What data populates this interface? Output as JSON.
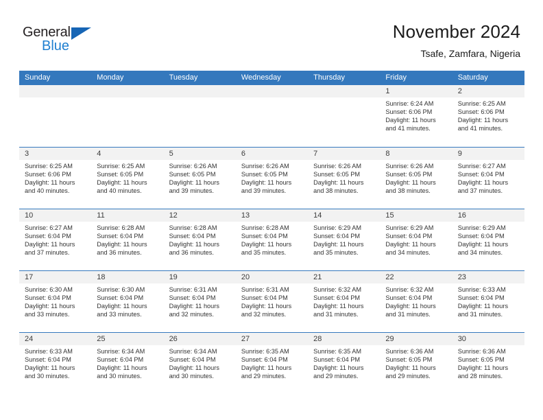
{
  "brand": {
    "name_part1": "General",
    "name_part2": "Blue",
    "triangle_color": "#1665b5",
    "blue_color": "#1f7fd0"
  },
  "header": {
    "title": "November 2024",
    "subtitle": "Tsafe, Zamfara, Nigeria"
  },
  "theme": {
    "header_bg": "#3478bd",
    "date_band_bg": "#f2f2f2",
    "row_border": "#3478bd",
    "text": "#333333"
  },
  "weekdays": [
    "Sunday",
    "Monday",
    "Tuesday",
    "Wednesday",
    "Thursday",
    "Friday",
    "Saturday"
  ],
  "weeks": [
    [
      {
        "date": "",
        "empty": true,
        "sunrise": "",
        "sunset": "",
        "daylight_line1": "",
        "daylight_line2": ""
      },
      {
        "date": "",
        "empty": true,
        "sunrise": "",
        "sunset": "",
        "daylight_line1": "",
        "daylight_line2": ""
      },
      {
        "date": "",
        "empty": true,
        "sunrise": "",
        "sunset": "",
        "daylight_line1": "",
        "daylight_line2": ""
      },
      {
        "date": "",
        "empty": true,
        "sunrise": "",
        "sunset": "",
        "daylight_line1": "",
        "daylight_line2": ""
      },
      {
        "date": "",
        "empty": true,
        "sunrise": "",
        "sunset": "",
        "daylight_line1": "",
        "daylight_line2": ""
      },
      {
        "date": "1",
        "empty": false,
        "sunrise": "Sunrise: 6:24 AM",
        "sunset": "Sunset: 6:06 PM",
        "daylight_line1": "Daylight: 11 hours",
        "daylight_line2": "and 41 minutes."
      },
      {
        "date": "2",
        "empty": false,
        "sunrise": "Sunrise: 6:25 AM",
        "sunset": "Sunset: 6:06 PM",
        "daylight_line1": "Daylight: 11 hours",
        "daylight_line2": "and 41 minutes."
      }
    ],
    [
      {
        "date": "3",
        "empty": false,
        "sunrise": "Sunrise: 6:25 AM",
        "sunset": "Sunset: 6:06 PM",
        "daylight_line1": "Daylight: 11 hours",
        "daylight_line2": "and 40 minutes."
      },
      {
        "date": "4",
        "empty": false,
        "sunrise": "Sunrise: 6:25 AM",
        "sunset": "Sunset: 6:05 PM",
        "daylight_line1": "Daylight: 11 hours",
        "daylight_line2": "and 40 minutes."
      },
      {
        "date": "5",
        "empty": false,
        "sunrise": "Sunrise: 6:26 AM",
        "sunset": "Sunset: 6:05 PM",
        "daylight_line1": "Daylight: 11 hours",
        "daylight_line2": "and 39 minutes."
      },
      {
        "date": "6",
        "empty": false,
        "sunrise": "Sunrise: 6:26 AM",
        "sunset": "Sunset: 6:05 PM",
        "daylight_line1": "Daylight: 11 hours",
        "daylight_line2": "and 39 minutes."
      },
      {
        "date": "7",
        "empty": false,
        "sunrise": "Sunrise: 6:26 AM",
        "sunset": "Sunset: 6:05 PM",
        "daylight_line1": "Daylight: 11 hours",
        "daylight_line2": "and 38 minutes."
      },
      {
        "date": "8",
        "empty": false,
        "sunrise": "Sunrise: 6:26 AM",
        "sunset": "Sunset: 6:05 PM",
        "daylight_line1": "Daylight: 11 hours",
        "daylight_line2": "and 38 minutes."
      },
      {
        "date": "9",
        "empty": false,
        "sunrise": "Sunrise: 6:27 AM",
        "sunset": "Sunset: 6:04 PM",
        "daylight_line1": "Daylight: 11 hours",
        "daylight_line2": "and 37 minutes."
      }
    ],
    [
      {
        "date": "10",
        "empty": false,
        "sunrise": "Sunrise: 6:27 AM",
        "sunset": "Sunset: 6:04 PM",
        "daylight_line1": "Daylight: 11 hours",
        "daylight_line2": "and 37 minutes."
      },
      {
        "date": "11",
        "empty": false,
        "sunrise": "Sunrise: 6:28 AM",
        "sunset": "Sunset: 6:04 PM",
        "daylight_line1": "Daylight: 11 hours",
        "daylight_line2": "and 36 minutes."
      },
      {
        "date": "12",
        "empty": false,
        "sunrise": "Sunrise: 6:28 AM",
        "sunset": "Sunset: 6:04 PM",
        "daylight_line1": "Daylight: 11 hours",
        "daylight_line2": "and 36 minutes."
      },
      {
        "date": "13",
        "empty": false,
        "sunrise": "Sunrise: 6:28 AM",
        "sunset": "Sunset: 6:04 PM",
        "daylight_line1": "Daylight: 11 hours",
        "daylight_line2": "and 35 minutes."
      },
      {
        "date": "14",
        "empty": false,
        "sunrise": "Sunrise: 6:29 AM",
        "sunset": "Sunset: 6:04 PM",
        "daylight_line1": "Daylight: 11 hours",
        "daylight_line2": "and 35 minutes."
      },
      {
        "date": "15",
        "empty": false,
        "sunrise": "Sunrise: 6:29 AM",
        "sunset": "Sunset: 6:04 PM",
        "daylight_line1": "Daylight: 11 hours",
        "daylight_line2": "and 34 minutes."
      },
      {
        "date": "16",
        "empty": false,
        "sunrise": "Sunrise: 6:29 AM",
        "sunset": "Sunset: 6:04 PM",
        "daylight_line1": "Daylight: 11 hours",
        "daylight_line2": "and 34 minutes."
      }
    ],
    [
      {
        "date": "17",
        "empty": false,
        "sunrise": "Sunrise: 6:30 AM",
        "sunset": "Sunset: 6:04 PM",
        "daylight_line1": "Daylight: 11 hours",
        "daylight_line2": "and 33 minutes."
      },
      {
        "date": "18",
        "empty": false,
        "sunrise": "Sunrise: 6:30 AM",
        "sunset": "Sunset: 6:04 PM",
        "daylight_line1": "Daylight: 11 hours",
        "daylight_line2": "and 33 minutes."
      },
      {
        "date": "19",
        "empty": false,
        "sunrise": "Sunrise: 6:31 AM",
        "sunset": "Sunset: 6:04 PM",
        "daylight_line1": "Daylight: 11 hours",
        "daylight_line2": "and 32 minutes."
      },
      {
        "date": "20",
        "empty": false,
        "sunrise": "Sunrise: 6:31 AM",
        "sunset": "Sunset: 6:04 PM",
        "daylight_line1": "Daylight: 11 hours",
        "daylight_line2": "and 32 minutes."
      },
      {
        "date": "21",
        "empty": false,
        "sunrise": "Sunrise: 6:32 AM",
        "sunset": "Sunset: 6:04 PM",
        "daylight_line1": "Daylight: 11 hours",
        "daylight_line2": "and 31 minutes."
      },
      {
        "date": "22",
        "empty": false,
        "sunrise": "Sunrise: 6:32 AM",
        "sunset": "Sunset: 6:04 PM",
        "daylight_line1": "Daylight: 11 hours",
        "daylight_line2": "and 31 minutes."
      },
      {
        "date": "23",
        "empty": false,
        "sunrise": "Sunrise: 6:33 AM",
        "sunset": "Sunset: 6:04 PM",
        "daylight_line1": "Daylight: 11 hours",
        "daylight_line2": "and 31 minutes."
      }
    ],
    [
      {
        "date": "24",
        "empty": false,
        "sunrise": "Sunrise: 6:33 AM",
        "sunset": "Sunset: 6:04 PM",
        "daylight_line1": "Daylight: 11 hours",
        "daylight_line2": "and 30 minutes."
      },
      {
        "date": "25",
        "empty": false,
        "sunrise": "Sunrise: 6:34 AM",
        "sunset": "Sunset: 6:04 PM",
        "daylight_line1": "Daylight: 11 hours",
        "daylight_line2": "and 30 minutes."
      },
      {
        "date": "26",
        "empty": false,
        "sunrise": "Sunrise: 6:34 AM",
        "sunset": "Sunset: 6:04 PM",
        "daylight_line1": "Daylight: 11 hours",
        "daylight_line2": "and 30 minutes."
      },
      {
        "date": "27",
        "empty": false,
        "sunrise": "Sunrise: 6:35 AM",
        "sunset": "Sunset: 6:04 PM",
        "daylight_line1": "Daylight: 11 hours",
        "daylight_line2": "and 29 minutes."
      },
      {
        "date": "28",
        "empty": false,
        "sunrise": "Sunrise: 6:35 AM",
        "sunset": "Sunset: 6:04 PM",
        "daylight_line1": "Daylight: 11 hours",
        "daylight_line2": "and 29 minutes."
      },
      {
        "date": "29",
        "empty": false,
        "sunrise": "Sunrise: 6:36 AM",
        "sunset": "Sunset: 6:05 PM",
        "daylight_line1": "Daylight: 11 hours",
        "daylight_line2": "and 29 minutes."
      },
      {
        "date": "30",
        "empty": false,
        "sunrise": "Sunrise: 6:36 AM",
        "sunset": "Sunset: 6:05 PM",
        "daylight_line1": "Daylight: 11 hours",
        "daylight_line2": "and 28 minutes."
      }
    ]
  ]
}
